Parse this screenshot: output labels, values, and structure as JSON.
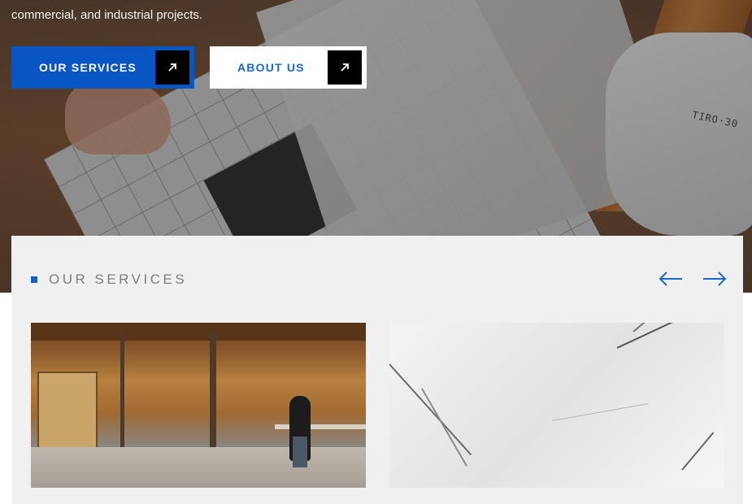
{
  "hero": {
    "text": "commercial, and industrial projects.",
    "primary_button": {
      "label": "OUR SERVICES",
      "icon": "arrow-up-right-icon"
    },
    "secondary_button": {
      "label": "ABOUT US",
      "icon": "arrow-up-right-icon"
    },
    "glove_print": "TIRO·30"
  },
  "services": {
    "title": "OUR SERVICES",
    "prev_icon": "arrow-left-icon",
    "next_icon": "arrow-right-icon"
  },
  "colors": {
    "primary_blue": "#0a55c4",
    "link_blue": "#1a6ac8",
    "panel_bg": "#f0f0f0",
    "muted_text": "#7d7d7d"
  }
}
